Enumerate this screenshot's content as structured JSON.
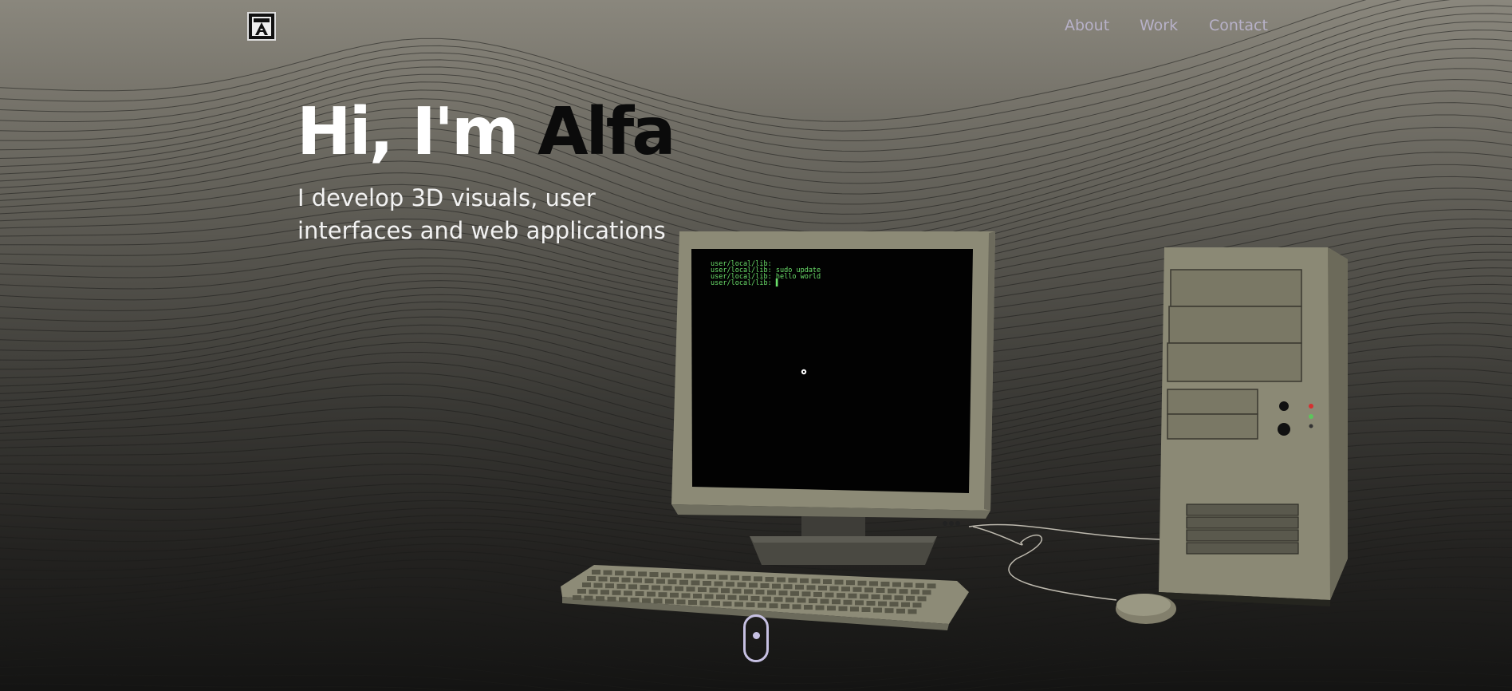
{
  "nav": {
    "logo_alt": "A",
    "links": [
      "About",
      "Work",
      "Contact"
    ]
  },
  "hero": {
    "greeting": "Hi, I'm",
    "name": "Alfa",
    "subtitle_line1": "I develop 3D visuals, user",
    "subtitle_line2": "interfaces and web applications"
  },
  "terminal": {
    "lines": [
      "user/local/lib:",
      "user/local/lib: sudo update",
      "user/local/lib: hello world",
      "user/local/lib: ▌"
    ]
  },
  "colors": {
    "nav_link": "#b7b1c8",
    "terminal_text": "#6be06b",
    "hero_name": "#0b0b0b",
    "scroll_indicator": "#c6c0e2"
  },
  "icons": {
    "scroll": "mouse-scroll-icon",
    "logo": "logo-icon"
  }
}
